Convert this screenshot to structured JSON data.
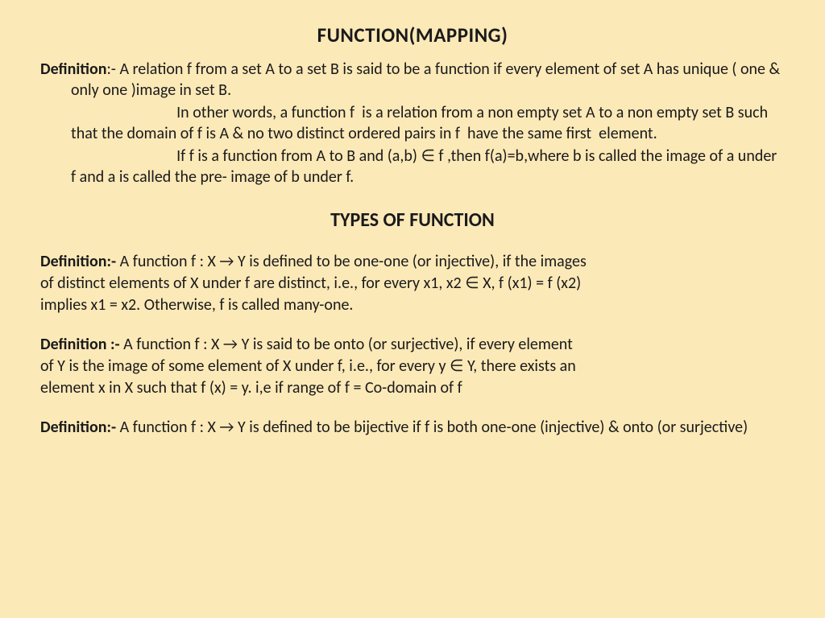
{
  "title": "FUNCTION(MAPPING)",
  "def1": {
    "label": "Definition",
    "part1": ":- A relation f from a set A to a set B is said to be a function if every element of set A has unique ( one & only one )image in set B.",
    "part2": "                             In other words, a function f  is a relation from a non empty set A to a non empty set B such that the domain of f is A & no two distinct ordered pairs in f  have the same first  element.",
    "part3": "                             If f is a function from A to B and (a,b) ∈ f ,then f(a)=b,where b is called the image of a under f and a is called the pre- image of b under f."
  },
  "subtitle": "TYPES OF FUNCTION",
  "def2": {
    "label": "Definition:-",
    "line1": " A function f : X → Y is defined to be one-one (or injective), if the images",
    "line2": "of distinct elements of X under f are distinct, i.e., for every x1, x2 ∈ X, f (x1) = f (x2)",
    "line3": "implies x1 = x2. Otherwise, f is called many-one."
  },
  "def3": {
    "label": "Definition :-",
    "line1": " A function f : X → Y is said to be onto (or surjective), if every element",
    "line2": "of Y is the image of some element of X under f, i.e., for every y ∈ Y, there exists an",
    "line3": "element x in X such that f (x) = y. i,e  if range of f = Co-domain of f"
  },
  "def4": {
    "label": "Definition:-",
    "line1": " A function f : X → Y is defined to be bijective if f is  both one-one (injective) & onto (or surjective)"
  }
}
